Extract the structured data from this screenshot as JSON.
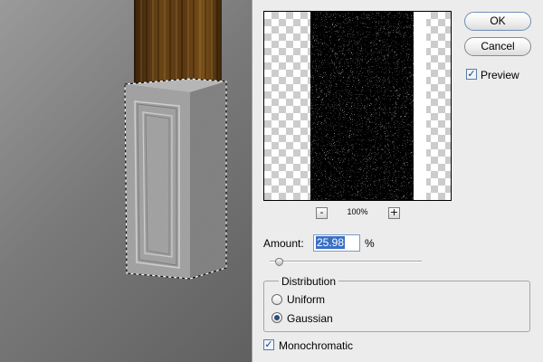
{
  "dialog": {
    "buttons": {
      "ok_label": "OK",
      "cancel_label": "Cancel"
    },
    "preview": {
      "label": "Preview",
      "checked": true
    },
    "zoom": {
      "minus": "-",
      "plus": "+",
      "level": "100%"
    },
    "amount": {
      "label": "Amount:",
      "value": "25.98",
      "unit": "%",
      "slider_fraction": 0.065
    },
    "distribution": {
      "title": "Distribution",
      "options": [
        {
          "label": "Uniform",
          "selected": false
        },
        {
          "label": "Gaussian",
          "selected": true
        }
      ]
    },
    "monochromatic": {
      "label": "Monochromatic",
      "checked": true
    }
  },
  "colors": {
    "dialog_bg": "#ececec",
    "selection_highlight": "#3a6fc6",
    "wood": "#5a3710",
    "stone": "#9e9e9e"
  },
  "icons": [
    "check-icon",
    "radio-selected-icon",
    "radio-empty-icon",
    "slider-thumb-icon"
  ]
}
